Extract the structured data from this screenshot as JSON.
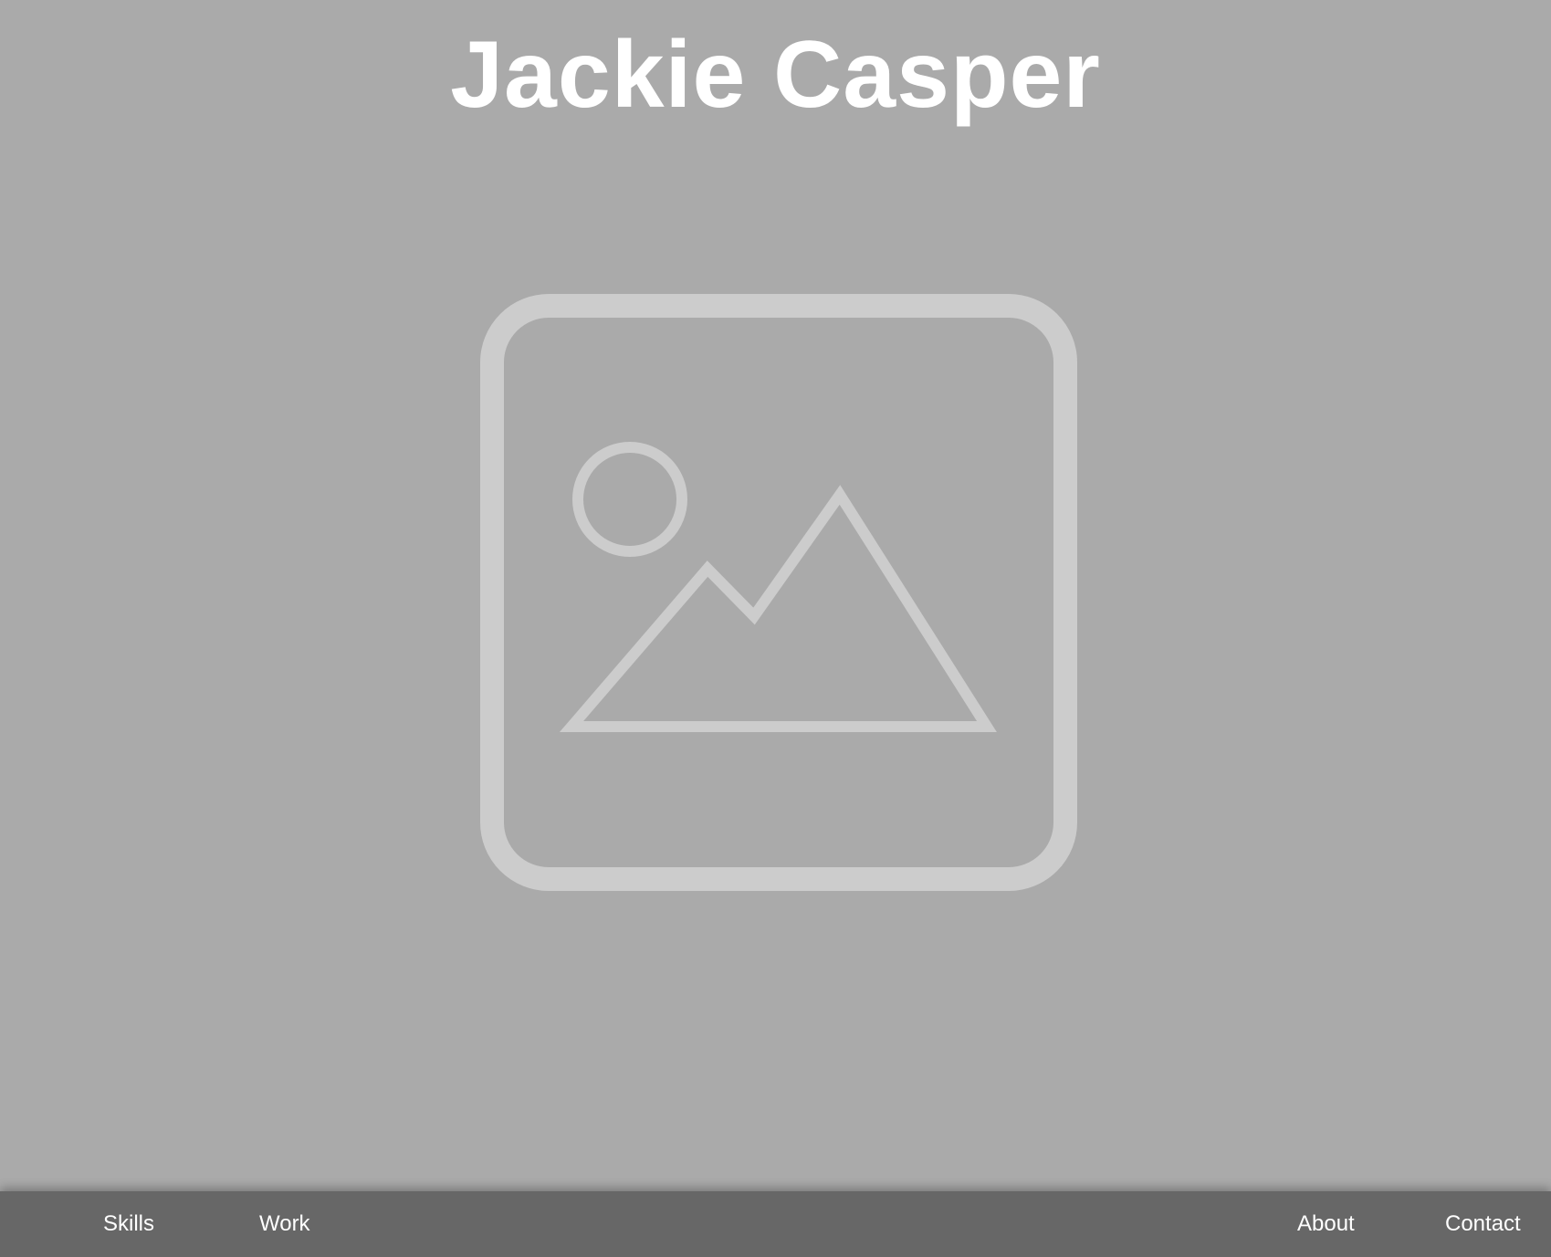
{
  "header": {
    "title": "Jackie Casper"
  },
  "hero": {
    "icon": "image-placeholder-icon",
    "icon_color": "#cccccc"
  },
  "nav": {
    "items": [
      {
        "label": "Skills"
      },
      {
        "label": "Work"
      },
      {
        "label": "About"
      },
      {
        "label": "Contact"
      }
    ]
  },
  "colors": {
    "background": "#aaaaaa",
    "nav_background": "#676767",
    "text": "#ffffff"
  }
}
